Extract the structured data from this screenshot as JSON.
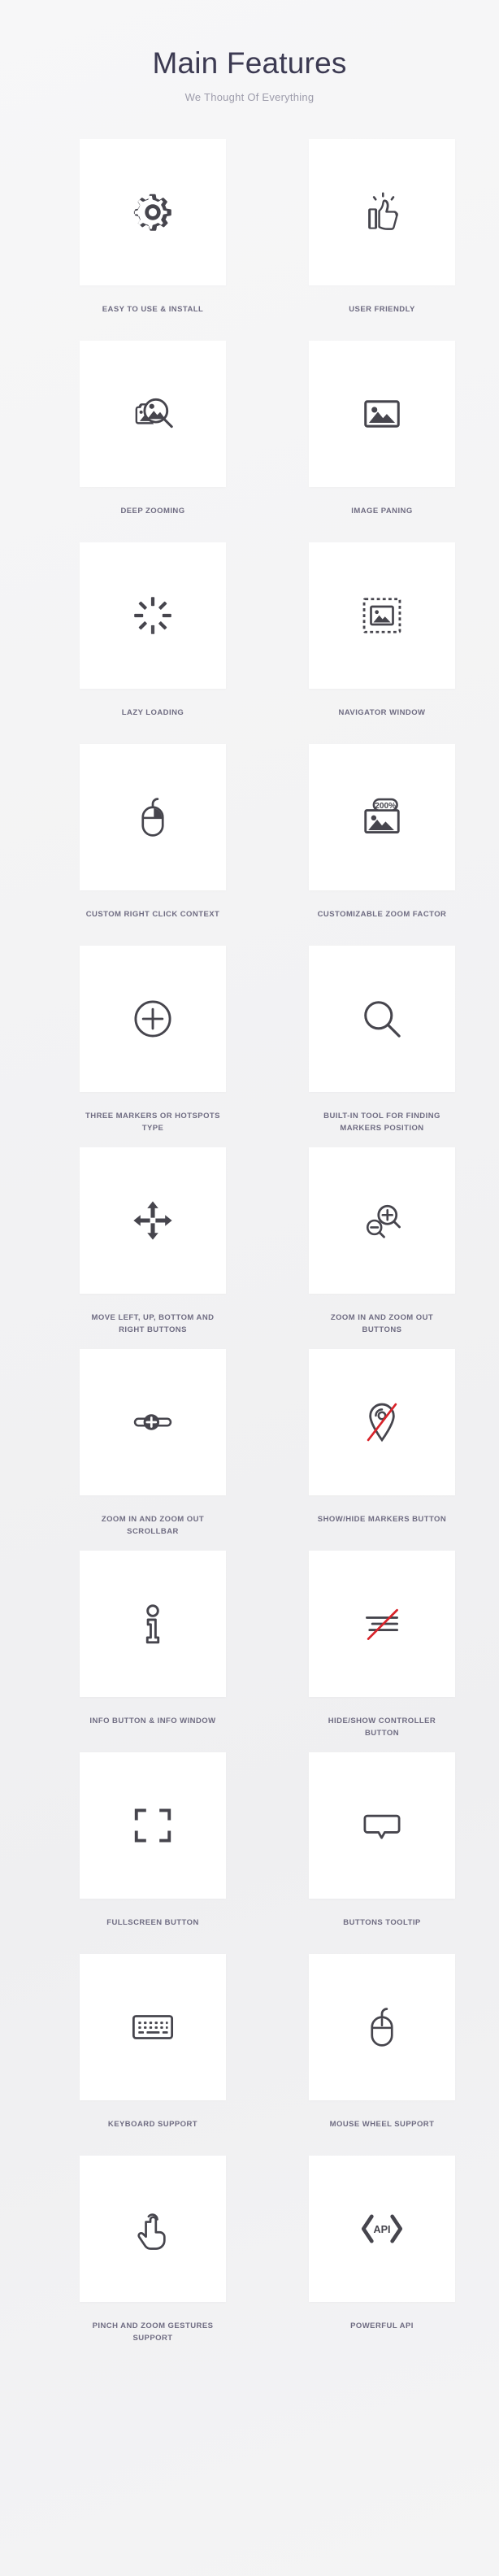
{
  "header": {
    "title": "Main Features",
    "subtitle": "We Thought Of Everything"
  },
  "colors": {
    "background": "#f3f3f4",
    "card": "#ffffff",
    "title": "#3c3a52",
    "subtitle": "#9d9cab",
    "label": "#6f6c82",
    "icon": "#46454d",
    "accent_red": "#d8232a"
  },
  "features": [
    {
      "icon": "gear-icon",
      "label": "EASY TO USE & INSTALL"
    },
    {
      "icon": "thumbs-up-icon",
      "label": "USER FRIENDLY"
    },
    {
      "icon": "image-magnifier-icon",
      "label": "DEEP ZOOMING"
    },
    {
      "icon": "image-icon",
      "label": "IMAGE PANING"
    },
    {
      "icon": "spinner-icon",
      "label": "LAZY LOADING"
    },
    {
      "icon": "navigator-window-icon",
      "label": "NAVIGATOR WINDOW"
    },
    {
      "icon": "mouse-right-click-icon",
      "label": "CUSTOM RIGHT CLICK CONTEXT"
    },
    {
      "icon": "zoom-factor-icon",
      "label": "CUSTOMIZABLE ZOOM FACTOR",
      "badge": "200%"
    },
    {
      "icon": "plus-circle-icon",
      "label": "THREE MARKERS OR HOTSPOTS TYPE"
    },
    {
      "icon": "magnifier-icon",
      "label": "BUILT-IN TOOL FOR FINDING MARKERS POSITION"
    },
    {
      "icon": "move-arrows-icon",
      "label": "MOVE LEFT, UP, BOTTOM AND RIGHT BUTTONS"
    },
    {
      "icon": "zoom-in-out-icon",
      "label": "ZOOM IN AND ZOOM OUT BUTTONS"
    },
    {
      "icon": "zoom-slider-icon",
      "label": "ZOOM IN AND ZOOM OUT SCROLLBAR"
    },
    {
      "icon": "marker-hidden-icon",
      "label": "SHOW/HIDE MARKERS BUTTON"
    },
    {
      "icon": "info-icon",
      "label": "INFO BUTTON & INFO WINDOW"
    },
    {
      "icon": "controller-hidden-icon",
      "label": "HIDE/SHOW CONTROLLER BUTTON"
    },
    {
      "icon": "fullscreen-icon",
      "label": "FULLSCREEN BUTTON"
    },
    {
      "icon": "tooltip-icon",
      "label": "BUTTONS TOOLTIP"
    },
    {
      "icon": "keyboard-icon",
      "label": "KEYBOARD SUPPORT"
    },
    {
      "icon": "mouse-wheel-icon",
      "label": "MOUSE WHEEL SUPPORT"
    },
    {
      "icon": "pinch-gesture-icon",
      "label": "PINCH AND ZOOM GESTURES SUPPORT"
    },
    {
      "icon": "api-icon",
      "label": "POWERFUL API",
      "badge": "API"
    }
  ]
}
